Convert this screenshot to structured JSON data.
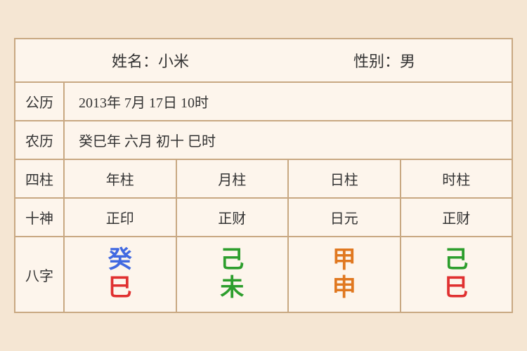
{
  "header": {
    "name_label": "姓名：小米",
    "gender_label": "性别：男"
  },
  "solar": {
    "label": "公历",
    "value": "2013年 7月 17日 10时"
  },
  "lunar": {
    "label": "农历",
    "value": "癸巳年 六月 初十 巳时"
  },
  "four_pillars": {
    "row_label": "四柱",
    "columns": [
      "年柱",
      "月柱",
      "日柱",
      "时柱"
    ]
  },
  "ten_gods": {
    "row_label": "十神",
    "columns": [
      "正印",
      "正财",
      "日元",
      "正财"
    ]
  },
  "bazi": {
    "row_label": "八字",
    "columns": [
      {
        "top": "癸",
        "bottom": "巳",
        "top_color": "blue",
        "bottom_color": "red"
      },
      {
        "top": "己",
        "bottom": "未",
        "top_color": "green",
        "bottom_color": "green"
      },
      {
        "top": "甲",
        "bottom": "申",
        "top_color": "orange",
        "bottom_color": "orange"
      },
      {
        "top": "己",
        "bottom": "巳",
        "top_color": "green",
        "bottom_color": "red"
      }
    ]
  }
}
